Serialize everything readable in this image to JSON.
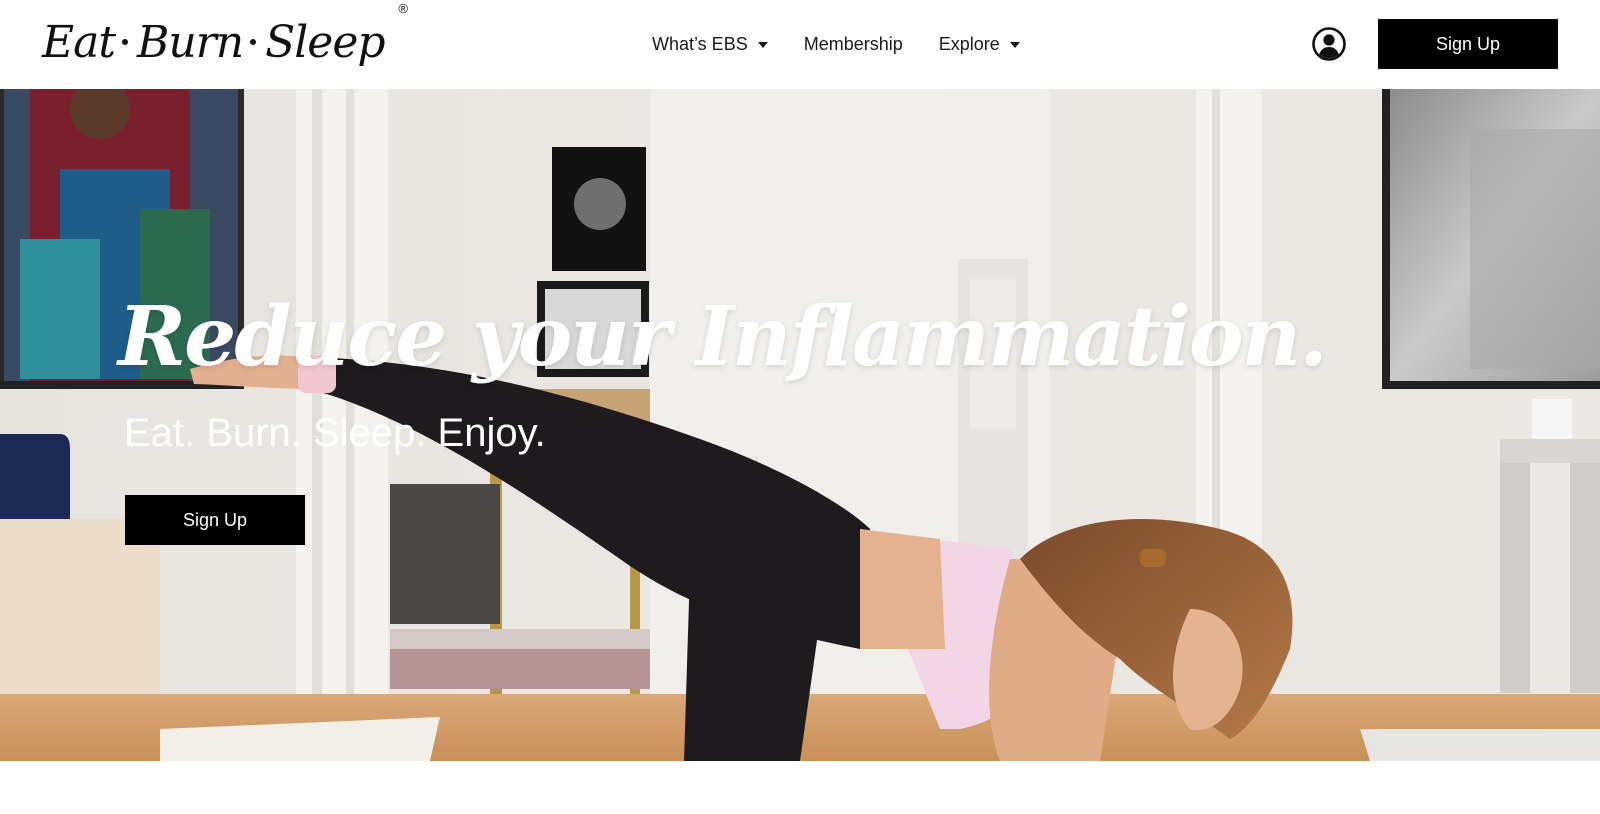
{
  "brand": {
    "logo_words": [
      "Eat",
      "Burn",
      "Sleep"
    ],
    "registered_mark": "®"
  },
  "nav": {
    "items": [
      {
        "label": "What’s EBS",
        "has_dropdown": true
      },
      {
        "label": "Membership",
        "has_dropdown": false
      },
      {
        "label": "Explore",
        "has_dropdown": true
      }
    ]
  },
  "header": {
    "account_icon": "user-circle-icon",
    "signup_label": "Sign Up"
  },
  "hero": {
    "title": "Reduce your Inflammation.",
    "subtitle": "Eat. Burn. Sleep. Enjoy.",
    "signup_label": "Sign Up",
    "image_subject": "woman doing kneeling leg lift in a bright living room"
  },
  "colors": {
    "button_bg": "#000000",
    "button_text": "#ffffff",
    "hero_text": "#ffffff",
    "page_bg": "#ffffff"
  }
}
